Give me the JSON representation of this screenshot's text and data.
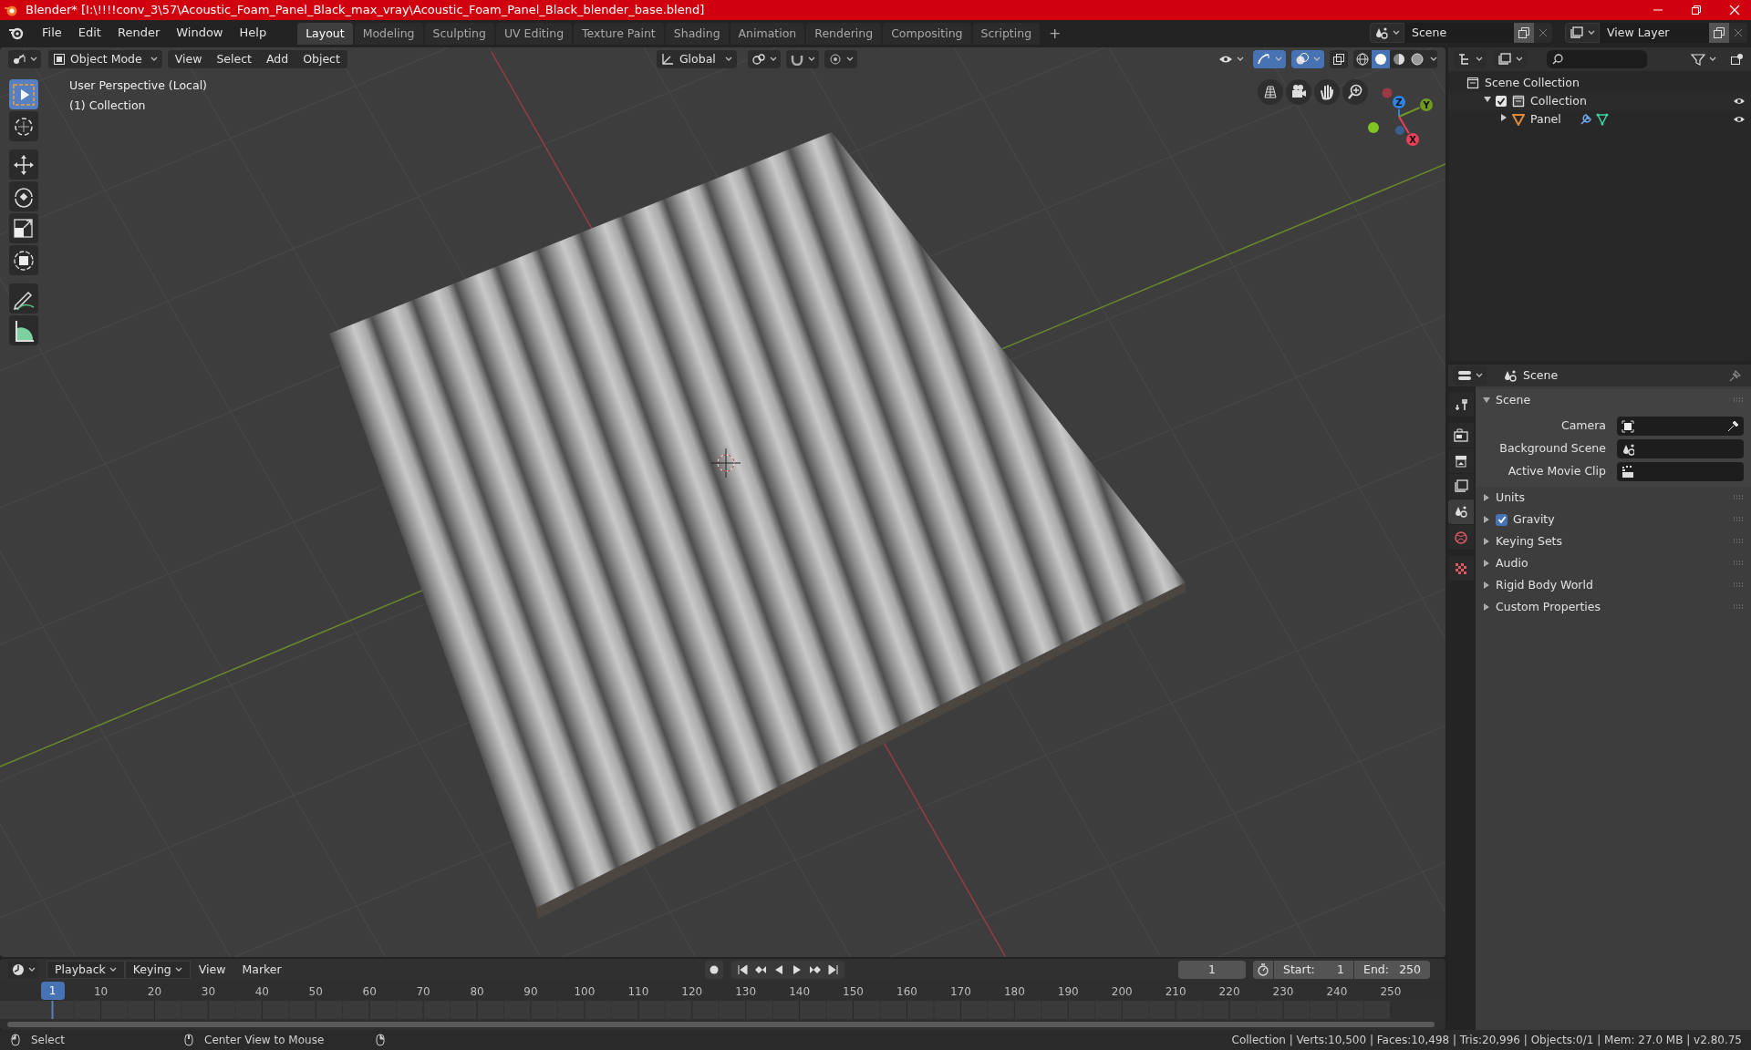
{
  "window": {
    "title": "Blender* [I:\\!!!!conv_3\\57\\Acoustic_Foam_Panel_Black_max_vray\\Acoustic_Foam_Panel_Black_blender_base.blend]"
  },
  "menu": [
    "File",
    "Edit",
    "Render",
    "Window",
    "Help"
  ],
  "workspace_tabs": [
    {
      "label": "Layout",
      "selected": true
    },
    {
      "label": "Modeling",
      "selected": false
    },
    {
      "label": "Sculpting",
      "selected": false
    },
    {
      "label": "UV Editing",
      "selected": false
    },
    {
      "label": "Texture Paint",
      "selected": false
    },
    {
      "label": "Shading",
      "selected": false
    },
    {
      "label": "Animation",
      "selected": false
    },
    {
      "label": "Rendering",
      "selected": false
    },
    {
      "label": "Compositing",
      "selected": false
    },
    {
      "label": "Scripting",
      "selected": false
    }
  ],
  "add_tab_label": "+",
  "scene_selector": {
    "value": "Scene"
  },
  "view_layer_selector": {
    "value": "View Layer"
  },
  "viewport": {
    "mode": "Object Mode",
    "menus": [
      "View",
      "Select",
      "Add",
      "Object"
    ],
    "orientation": "Global",
    "overlay_lines": [
      "User Perspective (Local)",
      "(1) Collection"
    ],
    "tools": [
      {
        "kind": "select",
        "selected": true
      },
      {
        "kind": "cursor",
        "selected": false
      },
      {
        "kind": "move",
        "selected": false
      },
      {
        "kind": "rotate",
        "selected": false
      },
      {
        "kind": "scale",
        "selected": false
      },
      {
        "kind": "transform",
        "selected": false
      },
      {
        "kind": "annotate",
        "selected": false
      },
      {
        "kind": "measure",
        "selected": false
      }
    ],
    "gizmo_axes": [
      {
        "label": "Z",
        "color": "#2f83e3"
      },
      {
        "label": "Y",
        "color": "#6f9a1f"
      },
      {
        "label": "X",
        "color": "#ee3f58"
      }
    ]
  },
  "outliner": {
    "items": [
      {
        "label": "Scene Collection",
        "children": [
          {
            "label": "Collection",
            "checked": true,
            "expanded": true,
            "children": [
              {
                "label": "Panel",
                "expanded": false
              }
            ]
          }
        ]
      }
    ]
  },
  "properties": {
    "header": "Scene",
    "tabs": [
      {
        "kind": "tool",
        "selected": false
      },
      {
        "kind": "render",
        "selected": false
      },
      {
        "kind": "output",
        "selected": false
      },
      {
        "kind": "view_layer",
        "selected": false
      },
      {
        "kind": "scene",
        "selected": true
      },
      {
        "kind": "world",
        "selected": false
      },
      {
        "kind": "texture",
        "selected": false
      }
    ],
    "panels": [
      {
        "label": "Scene",
        "expanded": true,
        "fields": [
          {
            "label": "Camera",
            "kind": "camera"
          },
          {
            "label": "Background Scene",
            "kind": "scene"
          },
          {
            "label": "Active Movie Clip",
            "kind": "clip"
          }
        ]
      },
      {
        "label": "Units",
        "expanded": false
      },
      {
        "label": "Gravity",
        "expanded": false,
        "checked": true
      },
      {
        "label": "Keying Sets",
        "expanded": false
      },
      {
        "label": "Audio",
        "expanded": false
      },
      {
        "label": "Rigid Body World",
        "expanded": false
      },
      {
        "label": "Custom Properties",
        "expanded": false
      }
    ]
  },
  "timeline": {
    "menus": [
      {
        "label": "Playback",
        "kind": "dropdown"
      },
      {
        "label": "Keying",
        "kind": "dropdown"
      },
      {
        "label": "View",
        "kind": "menu"
      },
      {
        "label": "Marker",
        "kind": "menu"
      }
    ],
    "current_frame": "1",
    "start_label": "Start:",
    "start": "1",
    "end_label": "End:",
    "end": "250",
    "frame_marker": "1",
    "ruler": [
      "10",
      "20",
      "30",
      "40",
      "50",
      "60",
      "70",
      "80",
      "90",
      "100",
      "110",
      "120",
      "130",
      "140",
      "150",
      "160",
      "170",
      "180",
      "190",
      "200",
      "210",
      "220",
      "230",
      "240",
      "250"
    ]
  },
  "status_bar": {
    "hints": [
      "Select",
      "Center View to Mouse"
    ],
    "stats": "Collection | Verts:10,500 | Faces:10,498 | Tris:20,996 | Objects:0/1 | Mem: 27.0 MB | v2.80.75"
  }
}
